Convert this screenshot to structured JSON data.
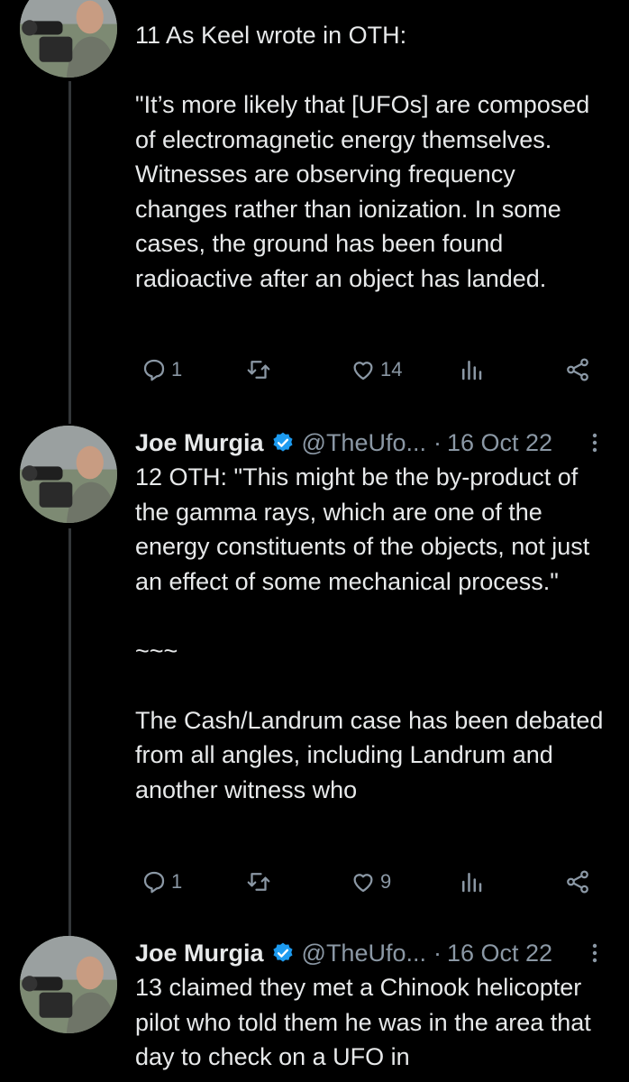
{
  "tweets": [
    {
      "text": "11 As Keel wrote in OTH:\n\n\"It’s more likely that [UFOs] are composed of electromagnetic energy themselves. Witnesses are observing frequency changes rather than ionization. In some cases, the ground has been found radioactive after an object has landed.",
      "replies": "1",
      "retweets": "",
      "likes": "14",
      "views": ""
    },
    {
      "name": "Joe Murgia",
      "handle": "@TheUfo...",
      "separator": "·",
      "date": "16 Oct 22",
      "text": "12 OTH: \"This might be the by-product of the gamma rays, which are one of the energy constituents of the objects, not just an effect of some mechanical process.\"\n\n~~~\n\nThe Cash/Landrum case has been debated from all angles, including Landrum and another witness who",
      "replies": "1",
      "retweets": "",
      "likes": "9",
      "views": ""
    },
    {
      "name": "Joe Murgia",
      "handle": "@TheUfo...",
      "separator": "·",
      "date": "16 Oct 22",
      "text": "13 claimed they met a Chinook helicopter pilot who told them he was in the area that day to check on a UFO in"
    }
  ],
  "colors": {
    "background": "#000000",
    "text": "#e7e9ea",
    "secondary": "#8b98a5",
    "verified": "#1d9bf0",
    "thread_line": "#333639"
  },
  "icons": [
    "reply-icon",
    "retweet-icon",
    "like-icon",
    "views-icon",
    "share-icon",
    "verified-badge-icon",
    "more-options-icon"
  ]
}
